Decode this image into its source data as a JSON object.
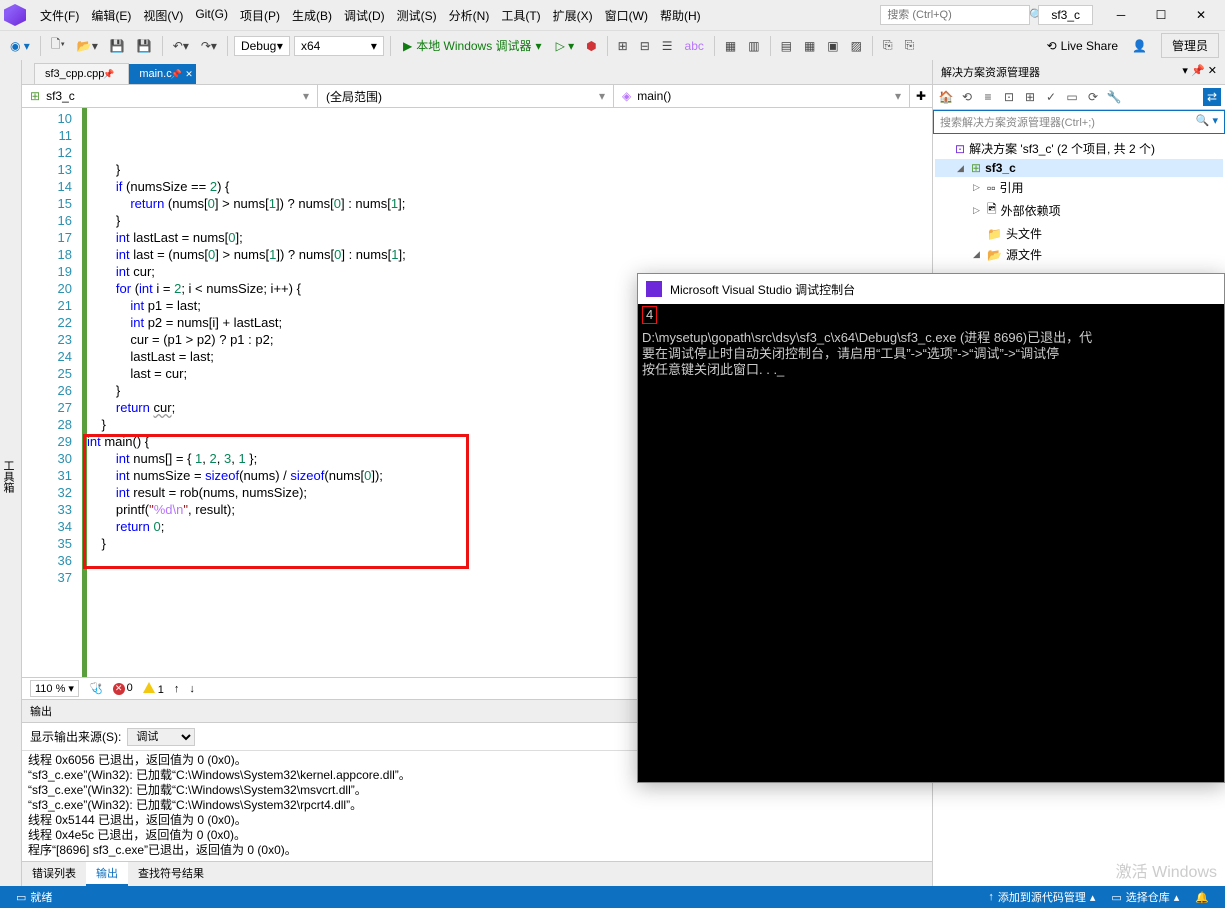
{
  "menus": [
    "文件(F)",
    "编辑(E)",
    "视图(V)",
    "Git(G)",
    "项目(P)",
    "生成(B)",
    "调试(D)",
    "测试(S)",
    "分析(N)",
    "工具(T)",
    "扩展(X)",
    "窗口(W)",
    "帮助(H)"
  ],
  "search_placeholder": "搜索 (Ctrl+Q)",
  "project_title": "sf3_c",
  "toolbar": {
    "config": "Debug",
    "platform": "x64",
    "run_label": "本地 Windows 调试器",
    "liveshare": "Live Share",
    "admin": "管理员"
  },
  "left_tool": "工具箱",
  "tabs": [
    {
      "label": "sf3_cpp.cpp",
      "active": false
    },
    {
      "label": "main.c",
      "active": true
    }
  ],
  "nav": {
    "scope": "sf3_c",
    "region": "(全局范围)",
    "member": "main()"
  },
  "code_first_line": 10,
  "code_lines": [
    "        }",
    "        <kw>if</kw> (numsSize == <num>2</num>) {",
    "            <kw>return</kw> (nums[<num>0</num>] > nums[<num>1</num>]) ? nums[<num>0</num>] : nums[<num>1</num>];",
    "        }",
    "",
    "        <kw>int</kw> lastLast = nums[<num>0</num>];",
    "        <kw>int</kw> last = (nums[<num>0</num>] > nums[<num>1</num>]) ? nums[<num>0</num>] : nums[<num>1</num>];",
    "        <kw>int</kw> cur;",
    "",
    "        <kw>for</kw> (<kw>int</kw> i = <num>2</num>; i < numsSize; i++) {",
    "            <kw>int</kw> p1 = last;",
    "            <kw>int</kw> p2 = nums[i] + lastLast;",
    "            cur = (p1 > p2) ? p1 : p2;",
    "            lastLast = last;",
    "            last = cur;",
    "        }",
    "        <kw>return</kw> <u style='text-decoration:underline wavy #999'>cur</u>;",
    "    }",
    "",
    "<kw>int</kw> main() {",
    "        <kw>int</kw> nums[] = { <num>1</num>, <num>2</num>, <num>3</num>, <num>1</num> };",
    "        <kw>int</kw> numsSize = <kw>sizeof</kw>(nums) / <kw>sizeof</kw>(nums[<num>0</num>]);",
    "        <kw>int</kw> result = rob(nums, numsSize);",
    "        printf(<str>\"</str><esc>%d\\n</esc><str>\"</str>, result);",
    "",
    "        <kw>return</kw> <num>0</num>;",
    "    }",
    ""
  ],
  "zoom": "110 %",
  "errors": "0",
  "warnings": "1",
  "output": {
    "title": "输出",
    "source_label": "显示输出来源(S):",
    "source": "调试",
    "lines": [
      "线程 0x6056 已退出，返回值为 0 (0x0)。",
      "“sf3_c.exe”(Win32): 已加载“C:\\Windows\\System32\\kernel.appcore.dll”。",
      "“sf3_c.exe”(Win32): 已加载“C:\\Windows\\System32\\msvcrt.dll”。",
      "“sf3_c.exe”(Win32): 已加载“C:\\Windows\\System32\\rpcrt4.dll”。",
      "线程 0x5144 已退出，返回值为 0 (0x0)。",
      "线程 0x4e5c 已退出，返回值为 0 (0x0)。",
      "程序“[8696] sf3_c.exe”已退出，返回值为 0 (0x0)。"
    ]
  },
  "bottom_tabs": [
    "错误列表",
    "输出",
    "查找符号结果"
  ],
  "bottom_active": "输出",
  "solution": {
    "title": "解决方案资源管理器",
    "search_placeholder": "搜索解决方案资源管理器(Ctrl+;)",
    "root": "解决方案 'sf3_c' (2 个项目, 共 2 个)",
    "project": "sf3_c",
    "nodes": [
      "引用",
      "外部依赖项",
      "头文件",
      "源文件"
    ]
  },
  "statusbar": {
    "ready": "就绪",
    "src": "添加到源代码管理",
    "repo": "选择仓库"
  },
  "console": {
    "title": "Microsoft Visual Studio 调试控制台",
    "output": "4",
    "lines": [
      "D:\\mysetup\\gopath\\src\\dsy\\sf3_c\\x64\\Debug\\sf3_c.exe (进程 8696)已退出，代",
      "要在调试停止时自动关闭控制台，请启用“工具”->“选项”->“调试”->“调试停",
      "按任意键关闭此窗口. . ._"
    ]
  },
  "watermark": "激活 Windows"
}
